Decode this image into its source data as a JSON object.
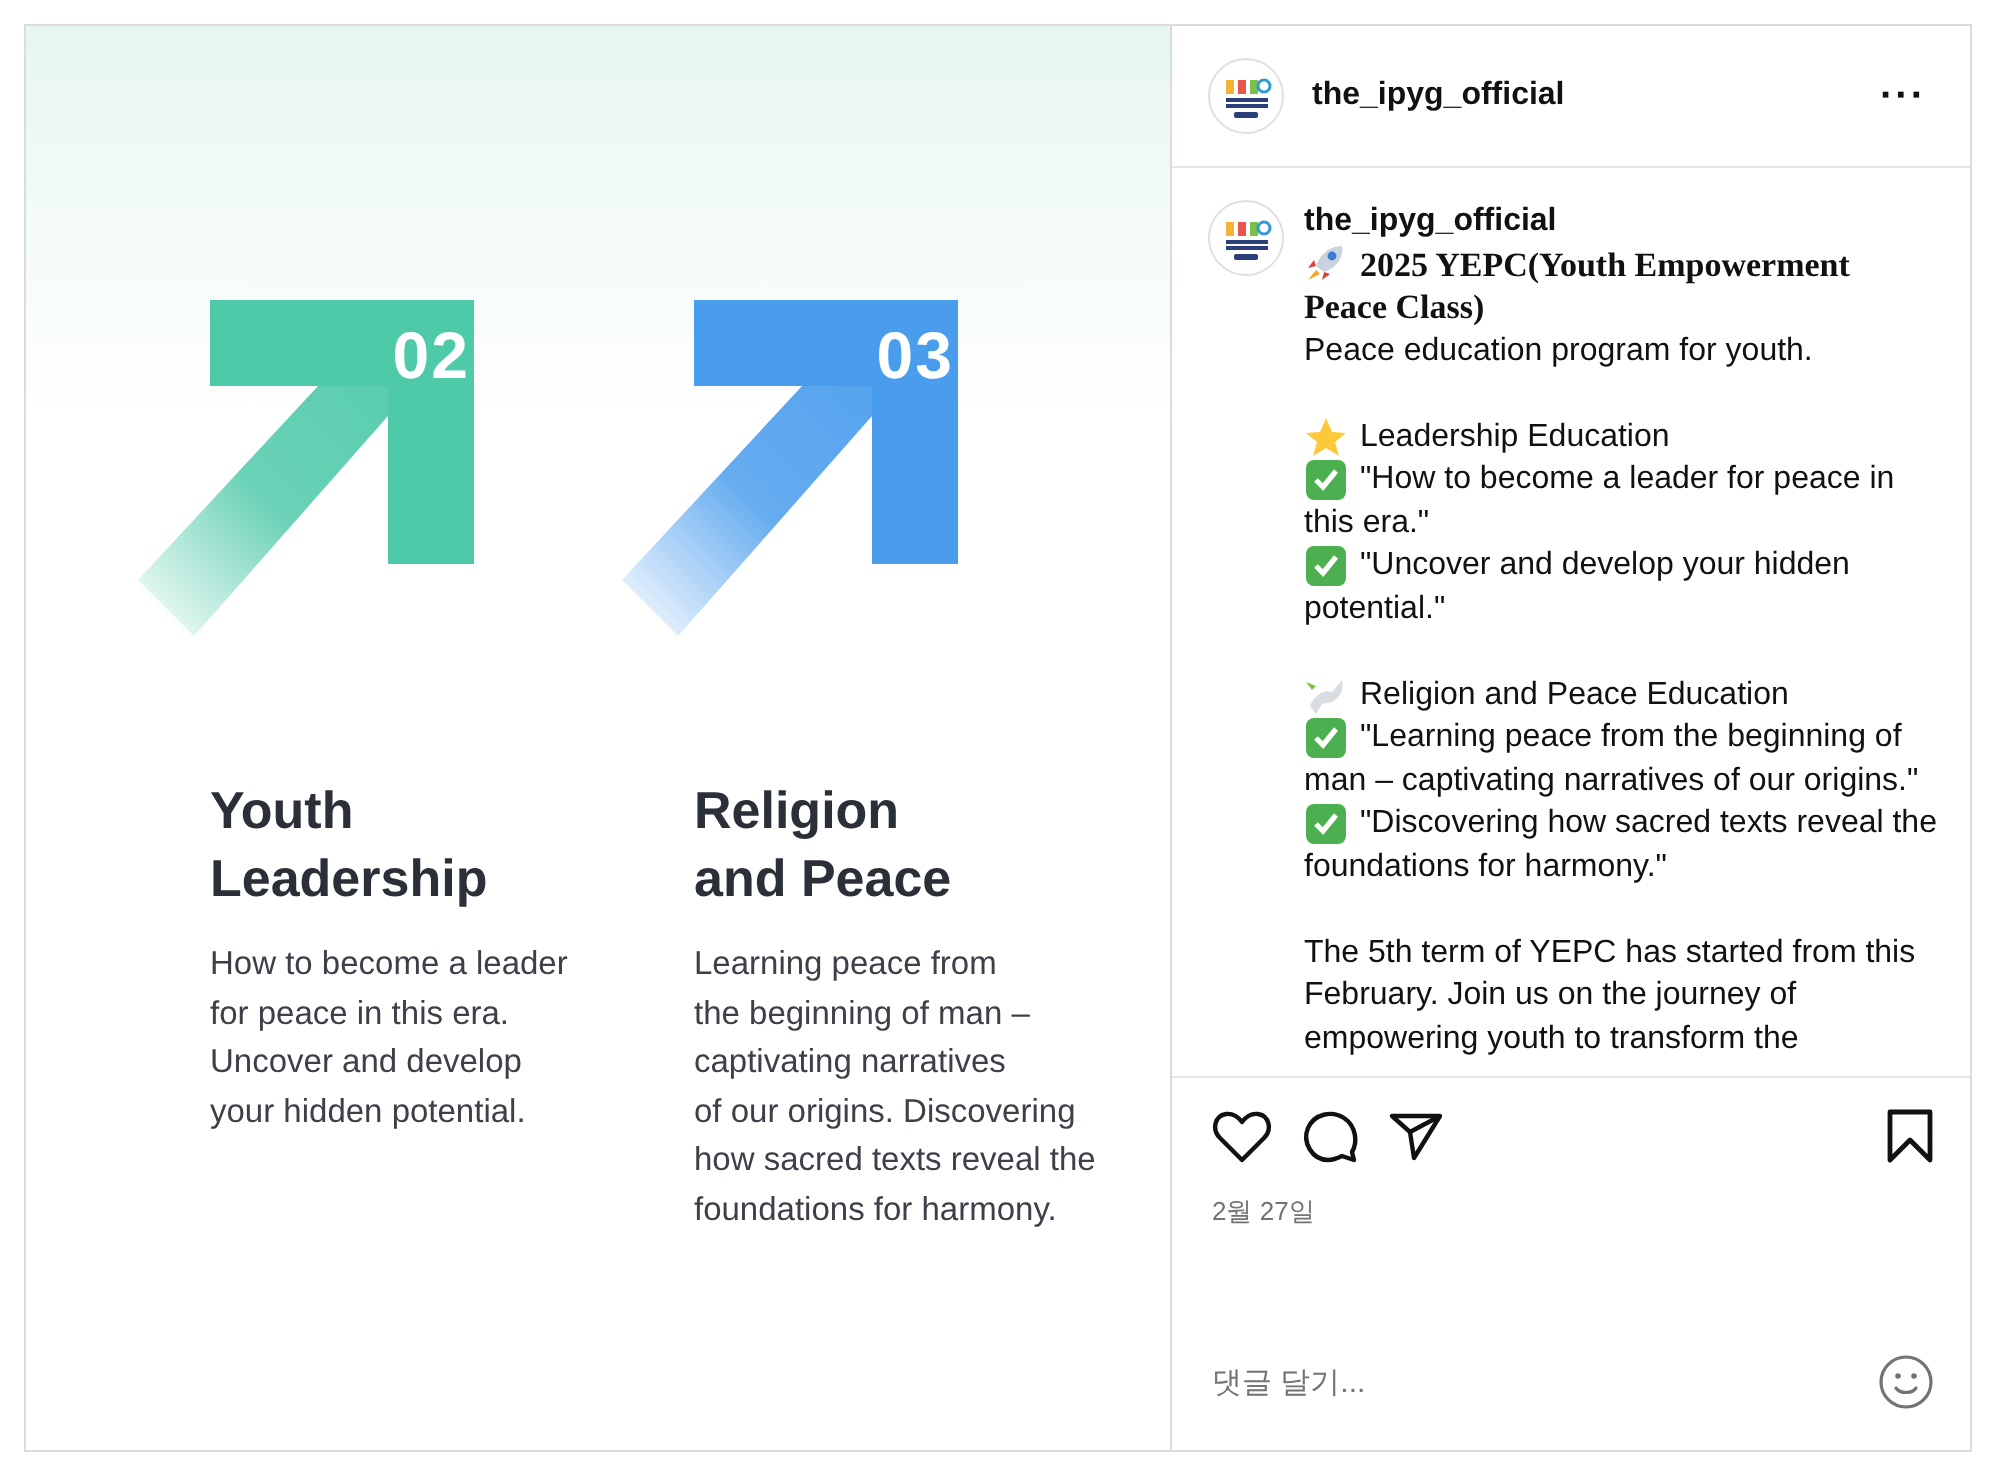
{
  "slide": {
    "columns": [
      {
        "number": "02",
        "color": "#4fcaa9",
        "title_lines": [
          "Youth",
          "Leadership"
        ],
        "body_lines": [
          "How to become a leader",
          "for peace in this era.",
          "Uncover and develop",
          "your hidden potential."
        ]
      },
      {
        "number": "03",
        "color": "#4a9ded",
        "title_lines": [
          "Religion",
          "and Peace"
        ],
        "body_lines": [
          "Learning peace from",
          "the beginning of man –",
          "captivating narratives",
          "of our origins. Discovering",
          "how sacred texts reveal the",
          "foundations for harmony."
        ]
      }
    ]
  },
  "header": {
    "username": "the_ipyg_official",
    "more": "···"
  },
  "caption": {
    "username": "the_ipyg_official",
    "paragraphs": [
      {
        "lines": [
          {
            "kind": "rocket-title",
            "text": "2025 YEPC(Youth Empowerment Peace Class)"
          },
          {
            "kind": "text",
            "text": "Peace education program for youth."
          }
        ]
      },
      {
        "lines": [
          {
            "kind": "star-heading",
            "text": "Leadership Education"
          },
          {
            "kind": "check-item",
            "text": "\"How to become a leader for peace in this era.\""
          },
          {
            "kind": "check-item",
            "text": "\"Uncover and develop your hidden potential.\""
          }
        ]
      },
      {
        "lines": [
          {
            "kind": "dove-heading",
            "text": "Religion and Peace Education"
          },
          {
            "kind": "check-item",
            "text": "\"Learning peace from the beginning of man – captivating narratives of our origins.\""
          },
          {
            "kind": "check-item",
            "text": "\"Discovering how sacred texts reveal the foundations for harmony.\""
          }
        ]
      },
      {
        "lines": [
          {
            "kind": "text",
            "text": "The 5th term of YEPC has started from this February. Join us on the journey of empowering youth to transform the"
          }
        ]
      }
    ]
  },
  "date": "2월 27일",
  "comment": {
    "placeholder": "댓글 달기..."
  }
}
